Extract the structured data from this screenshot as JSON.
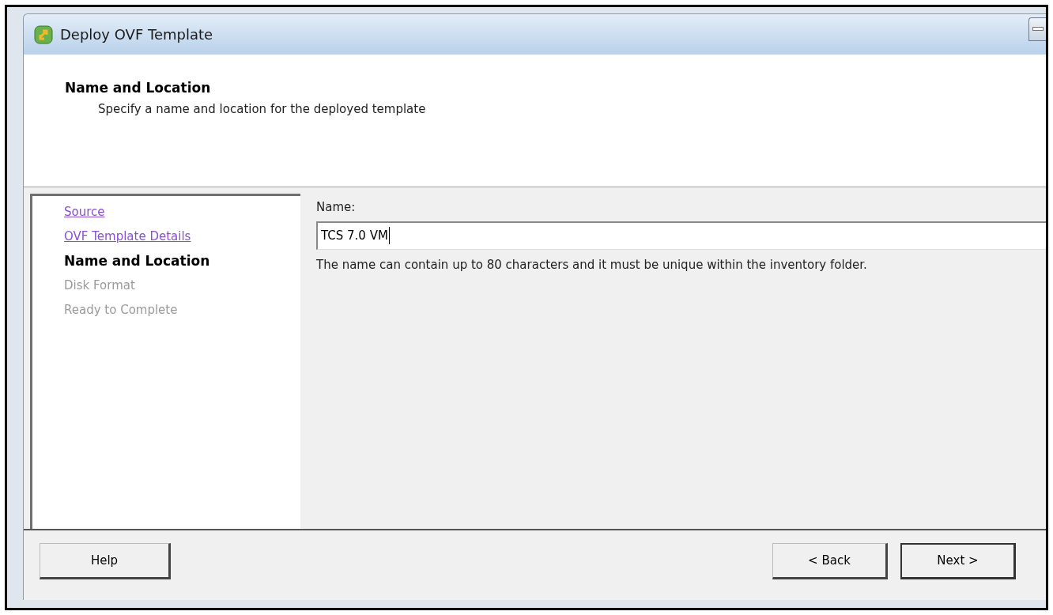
{
  "window": {
    "title": "Deploy OVF Template"
  },
  "header": {
    "title": "Name and Location",
    "subtitle": "Specify a name and location for the deployed template"
  },
  "steps": [
    {
      "label": "Source",
      "kind": "done"
    },
    {
      "label": "OVF Template Details",
      "kind": "done"
    },
    {
      "label": "Name and Location",
      "kind": "current"
    },
    {
      "label": "Disk Format",
      "kind": "pending"
    },
    {
      "label": "Ready to Complete",
      "kind": "pending"
    }
  ],
  "name_field": {
    "label": "Name:",
    "value": "TCS 7.0 VM",
    "hint": "The name can contain up to 80 characters and it must be unique within the inventory folder."
  },
  "buttons": {
    "help": "Help",
    "back": "< Back",
    "next": "Next >"
  }
}
